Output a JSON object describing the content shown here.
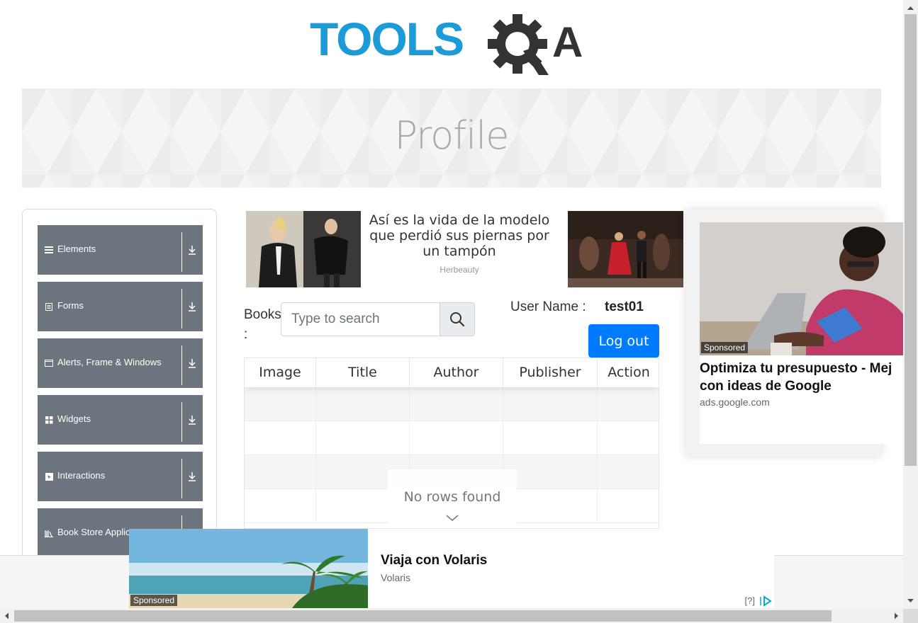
{
  "logo": {
    "text": "TOOLSQA",
    "left_text": "TOOLS",
    "right_text": "A",
    "colors": {
      "blue": "#1b9bd7",
      "dark": "#333333"
    }
  },
  "banner": {
    "title": "Profile"
  },
  "sidebar": {
    "groups": [
      {
        "label": "Elements",
        "icon": "hamburger-icon"
      },
      {
        "label": "Forms",
        "icon": "document-icon"
      },
      {
        "label": "Alerts, Frame & Windows",
        "icon": "window-icon"
      },
      {
        "label": "Widgets",
        "icon": "grid-icon"
      },
      {
        "label": "Interactions",
        "icon": "cursor-icon"
      },
      {
        "label": "Book Store Applica",
        "icon": "books-icon"
      }
    ]
  },
  "ad_top": {
    "headline": "Así es la vida de la modelo que perdió sus piernas por un tampón",
    "source": "Herbeauty"
  },
  "books_label": "Books :",
  "search": {
    "placeholder": "Type to search"
  },
  "user": {
    "label": "User Name :",
    "value": "test01"
  },
  "logout_label": "Log out",
  "table": {
    "columns": [
      "Image",
      "Title",
      "Author",
      "Publisher",
      "Action"
    ],
    "empty_message": "No rows found"
  },
  "ad_right": {
    "sponsored": "Sponsored",
    "title": "Optimiza tu presupuesto - Mej con ideas de Google",
    "domain": "ads.google.com"
  },
  "ad_bottom": {
    "sponsored": "Sponsored",
    "title": "Viaja con Volaris",
    "source": "Volaris",
    "help": "[?]"
  },
  "colors": {
    "sidebar_group": "#6c757d",
    "primary": "#007bff",
    "banner_title": "#a9a9a9"
  }
}
